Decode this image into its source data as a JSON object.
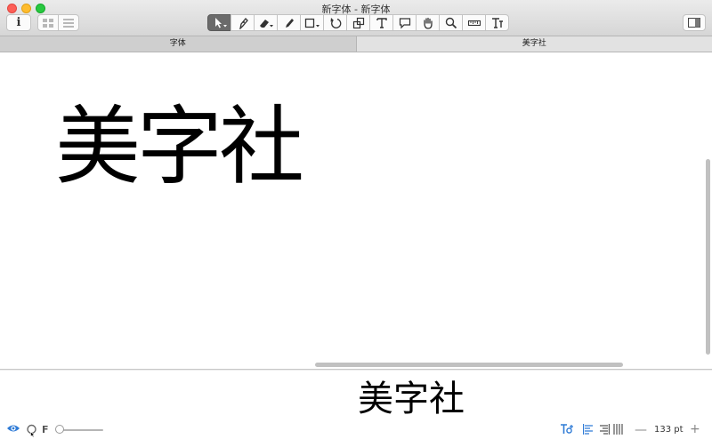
{
  "window": {
    "title": "新字体 - 新字体"
  },
  "toolbar": {
    "info_label": "i",
    "tools": [
      "pointer-icon",
      "pen-icon",
      "eraser-icon",
      "pencil-icon",
      "rectangle-icon",
      "rotate-icon",
      "scale-icon",
      "text-tool-icon",
      "speech-bubble-icon",
      "hand-icon",
      "zoom-icon",
      "ruler-icon",
      "glyph-text-icon"
    ]
  },
  "tabs": [
    {
      "label": "字体",
      "active": true
    },
    {
      "label": "美字社",
      "active": false
    }
  ],
  "canvas": {
    "text": "美字社"
  },
  "preview": {
    "text": "美字社"
  },
  "bottombar": {
    "f_label": "F",
    "size_value": "133 pt",
    "minus_label": "—",
    "plus_label": "+"
  },
  "colors": {
    "accent": "#2f7bd6",
    "selected_tool": "#6b6b6b"
  }
}
